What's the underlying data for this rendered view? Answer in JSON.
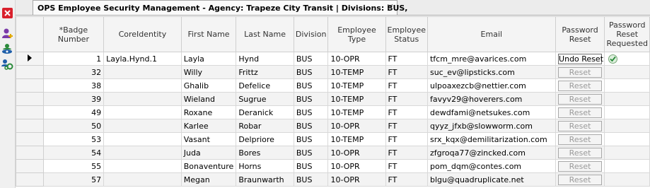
{
  "tab": {
    "title": "OPS Employee Security Management - Agency: Trapeze City Transit | Divisions: BUS,",
    "close": "×"
  },
  "toolbar": {
    "icons": [
      "close-icon",
      "add-user-icon",
      "users-icon",
      "users-link-icon"
    ]
  },
  "columns": {
    "badge": "*Badge Number",
    "core": "CoreIdentity",
    "first": "First Name",
    "last": "Last Name",
    "division": "Division",
    "type": "Employee Type",
    "status": "Employee Status",
    "email": "Email",
    "reset": "Password Reset",
    "requested": "Password Reset Requested"
  },
  "rows": [
    {
      "badge": "1",
      "core": "Layla.Hynd.1",
      "first": "Layla",
      "last": "Hynd",
      "division": "BUS",
      "type": "10-OPR",
      "status": "FT",
      "email": "tfcm_mre@avarices.com",
      "action": "Undo Reset",
      "active": true,
      "requested": true,
      "current": true
    },
    {
      "badge": "32",
      "core": "",
      "first": "Willy",
      "last": "Frittz",
      "division": "BUS",
      "type": "10-TEMP",
      "status": "FT",
      "email": "suc_ev@lipsticks.com",
      "action": "Reset",
      "active": false,
      "requested": false
    },
    {
      "badge": "38",
      "core": "",
      "first": "Ghalib",
      "last": "Defelice",
      "division": "BUS",
      "type": "10-TEMP",
      "status": "FT",
      "email": "ulpoaxezcb@nettier.com",
      "action": "Reset",
      "active": false,
      "requested": false
    },
    {
      "badge": "39",
      "core": "",
      "first": "Wieland",
      "last": "Sugrue",
      "division": "BUS",
      "type": "10-TEMP",
      "status": "FT",
      "email": "favyv29@hoverers.com",
      "action": "Reset",
      "active": false,
      "requested": false
    },
    {
      "badge": "49",
      "core": "",
      "first": "Roxane",
      "last": "Deranick",
      "division": "BUS",
      "type": "10-TEMP",
      "status": "FT",
      "email": "dewdfami@netsukes.com",
      "action": "Reset",
      "active": false,
      "requested": false
    },
    {
      "badge": "50",
      "core": "",
      "first": "Karlee",
      "last": "Robar",
      "division": "BUS",
      "type": "10-OPR",
      "status": "FT",
      "email": "qyyz_jfxb@slowworm.com",
      "action": "Reset",
      "active": false,
      "requested": false
    },
    {
      "badge": "53",
      "core": "",
      "first": "Vasant",
      "last": "Delpriore",
      "division": "BUS",
      "type": "10-TEMP",
      "status": "FT",
      "email": "srx_kqx@demilitarization.com",
      "action": "Reset",
      "active": false,
      "requested": false
    },
    {
      "badge": "54",
      "core": "",
      "first": "Juda",
      "last": "Bores",
      "division": "BUS",
      "type": "10-OPR",
      "status": "FT",
      "email": "zfgroqa77@zincked.com",
      "action": "Reset",
      "active": false,
      "requested": false
    },
    {
      "badge": "55",
      "core": "",
      "first": "Bonaventure",
      "last": "Horns",
      "division": "BUS",
      "type": "10-OPR",
      "status": "FT",
      "email": "pom_dqm@contes.com",
      "action": "Reset",
      "active": false,
      "requested": false
    },
    {
      "badge": "57",
      "core": "",
      "first": "Megan",
      "last": "Braunwarth",
      "division": "BUS",
      "type": "10-OPR",
      "status": "FT",
      "email": "blgu@quadruplicate.net",
      "action": "Reset",
      "active": false,
      "requested": false
    }
  ]
}
